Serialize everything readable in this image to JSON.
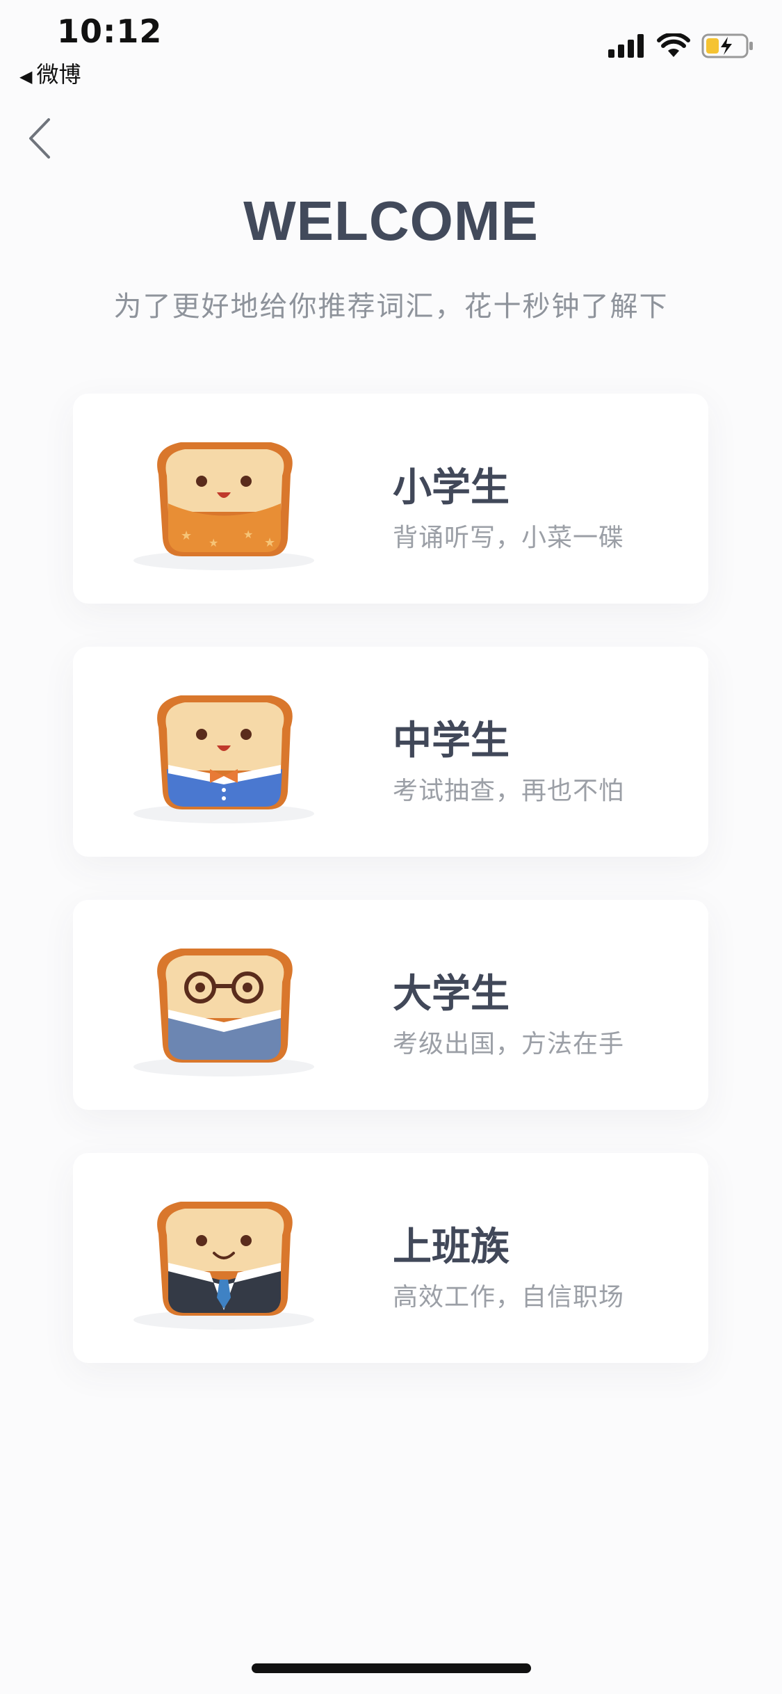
{
  "status_bar": {
    "time": "10:12",
    "back_app_label": "微博",
    "battery_color": "#f5c332"
  },
  "nav": {
    "back_icon": "chevron-left-icon"
  },
  "header": {
    "title": "WELCOME",
    "subtitle": "为了更好地给你推荐词汇，花十秒钟了解下"
  },
  "options": [
    {
      "title": "小学生",
      "desc": "背诵听写，小菜一碟",
      "avatar": "toast-orange-stars-icon"
    },
    {
      "title": "中学生",
      "desc": "考试抽查，再也不怕",
      "avatar": "toast-bowtie-icon"
    },
    {
      "title": "大学生",
      "desc": "考级出国，方法在手",
      "avatar": "toast-glasses-icon"
    },
    {
      "title": "上班族",
      "desc": "高效工作，自信职场",
      "avatar": "toast-suit-icon"
    }
  ],
  "colors": {
    "title": "#424a5b",
    "subtitle": "#8e939b",
    "toast_crust": "#e08a3a",
    "toast_face": "#f6d9a8"
  }
}
